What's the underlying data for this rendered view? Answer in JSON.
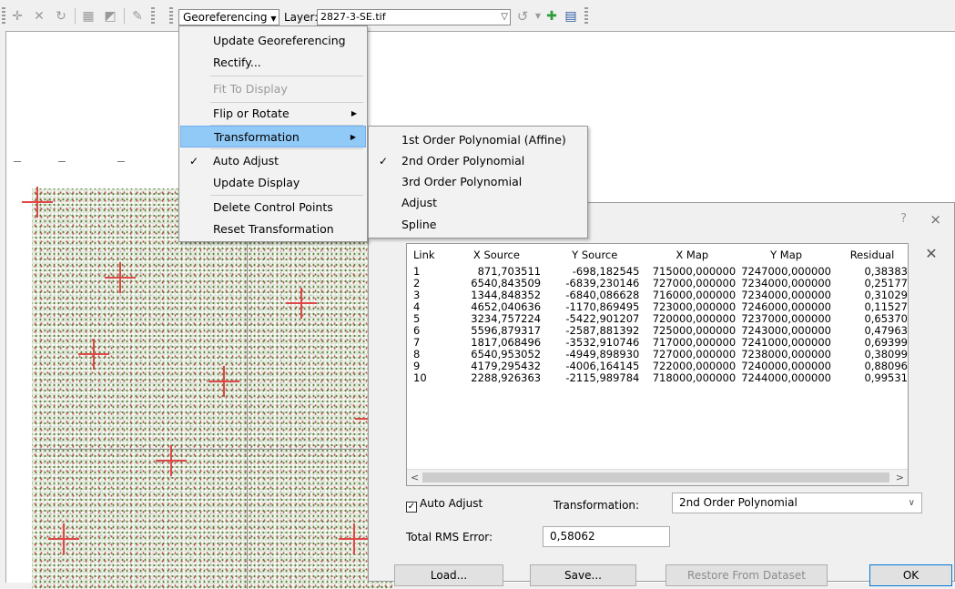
{
  "toolbar": {
    "georeferencing_label": "Georeferencing",
    "layer_label": "Layer:",
    "layer_value": "2827-3-SE.tif",
    "icons": [
      "add-control-points-icon",
      "delete-link-icon",
      "rotate-icon",
      "table-icon",
      "view-link-table-icon"
    ]
  },
  "georef_menu": {
    "items": [
      {
        "label": "Update Georeferencing",
        "enabled": true
      },
      {
        "label": "Rectify...",
        "enabled": true
      },
      {
        "label": "Fit To Display",
        "enabled": false
      },
      {
        "label": "Flip or Rotate",
        "enabled": true,
        "submenu": true
      },
      {
        "label": "Transformation",
        "enabled": true,
        "submenu": true,
        "highlighted": true
      },
      {
        "label": "Auto Adjust",
        "enabled": true,
        "checked": true
      },
      {
        "label": "Update Display",
        "enabled": true
      },
      {
        "label": "Delete Control Points",
        "enabled": true
      },
      {
        "label": "Reset Transformation",
        "enabled": true
      }
    ]
  },
  "transformation_submenu": {
    "items": [
      {
        "label": "1st Order Polynomial (Affine)",
        "checked": false
      },
      {
        "label": "2nd Order Polynomial",
        "checked": true
      },
      {
        "label": "3rd Order Polynomial",
        "checked": false
      },
      {
        "label": "Adjust",
        "checked": false
      },
      {
        "label": "Spline",
        "checked": false
      }
    ]
  },
  "link_table": {
    "help": "?",
    "close": "×",
    "columns": [
      "Link",
      "X Source",
      "Y Source",
      "X Map",
      "Y Map",
      "Residual"
    ],
    "rows": [
      [
        "1",
        "871,703511",
        "-698,182545",
        "715000,000000",
        "7247000,000000",
        "0,38383"
      ],
      [
        "2",
        "6540,843509",
        "-6839,230146",
        "727000,000000",
        "7234000,000000",
        "0,25177"
      ],
      [
        "3",
        "1344,848352",
        "-6840,086628",
        "716000,000000",
        "7234000,000000",
        "0,31029"
      ],
      [
        "4",
        "4652,040636",
        "-1170,869495",
        "723000,000000",
        "7246000,000000",
        "0,11527"
      ],
      [
        "5",
        "3234,757224",
        "-5422,901207",
        "720000,000000",
        "7237000,000000",
        "0,65370"
      ],
      [
        "6",
        "5596,879317",
        "-2587,881392",
        "725000,000000",
        "7243000,000000",
        "0,47963"
      ],
      [
        "7",
        "1817,068496",
        "-3532,910746",
        "717000,000000",
        "7241000,000000",
        "0,69399"
      ],
      [
        "8",
        "6540,953052",
        "-4949,898930",
        "727000,000000",
        "7238000,000000",
        "0,38099"
      ],
      [
        "9",
        "4179,295432",
        "-4006,164145",
        "722000,000000",
        "7240000,000000",
        "0,88096"
      ],
      [
        "10",
        "2288,926363",
        "-2115,989784",
        "718000,000000",
        "7244000,000000",
        "0,99531"
      ]
    ],
    "auto_adjust_label": "Auto Adjust",
    "auto_adjust_checked": true,
    "transformation_label": "Transformation:",
    "transformation_value": "2nd Order Polynomial",
    "rms_label": "Total RMS Error:",
    "rms_value": "0,58062",
    "buttons": {
      "load": "Load...",
      "save": "Save...",
      "restore": "Restore From Dataset",
      "ok": "OK"
    }
  },
  "colors": {
    "highlight": "#91c9f7",
    "control_point": "#e04848"
  }
}
